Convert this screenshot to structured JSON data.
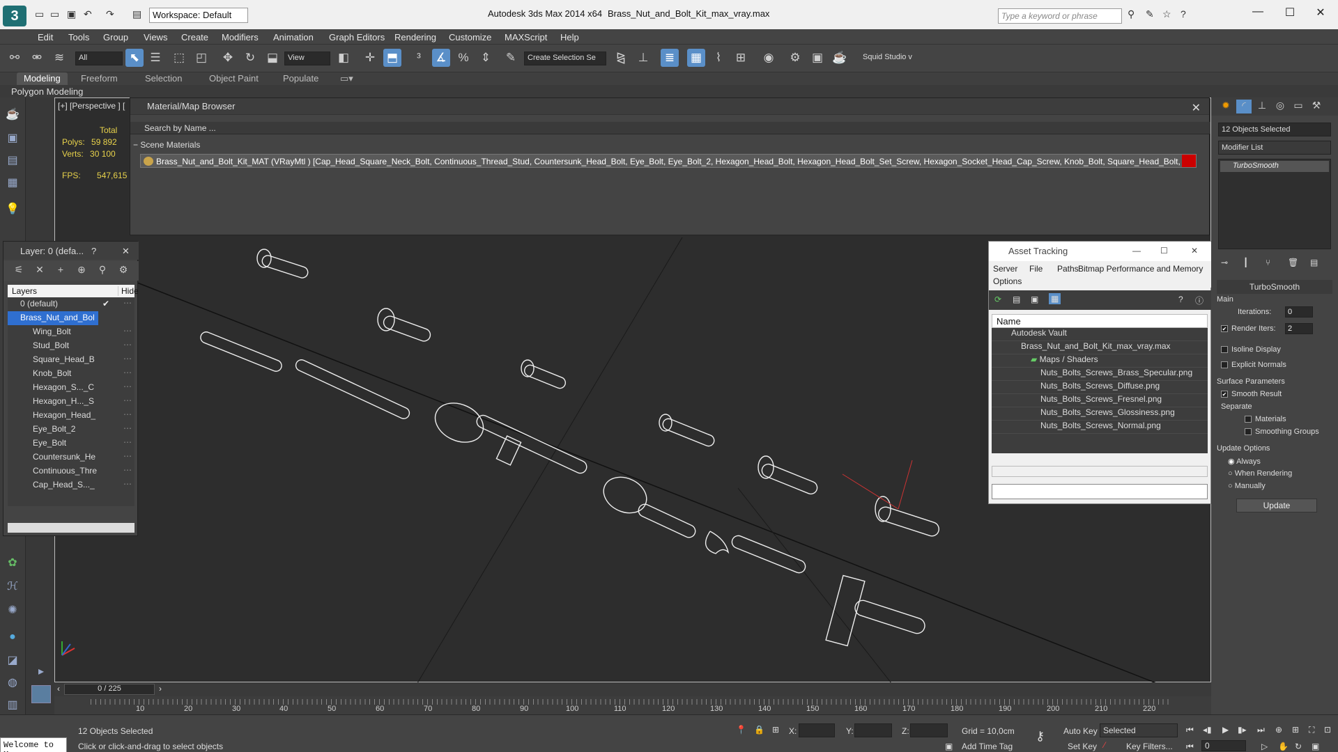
{
  "titlebar": {
    "app": "Autodesk 3ds Max  2014 x64",
    "file": "Brass_Nut_and_Bolt_Kit_max_vray.max",
    "workspace": "Workspace: Default",
    "search_placeholder": "Type a keyword or phrase"
  },
  "menu": [
    "Edit",
    "Tools",
    "Group",
    "Views",
    "Create",
    "Modifiers",
    "Animation",
    "Graph Editors",
    "Rendering",
    "Customize",
    "MAXScript",
    "Help"
  ],
  "toolbar": {
    "filter": "All",
    "refcoord": "View",
    "selset": "Create Selection Se",
    "plugin": "Squid Studio v"
  },
  "ribbon": {
    "tabs": [
      "Modeling",
      "Freeform",
      "Selection",
      "Object Paint",
      "Populate"
    ],
    "sub": "Polygon Modeling"
  },
  "viewport": {
    "label": "[+] [Perspective ] [",
    "stats": {
      "total": "Total",
      "polys_label": "Polys:",
      "polys": "59 892",
      "verts_label": "Verts:",
      "verts": "30 100",
      "fps_label": "FPS:",
      "fps": "547,615"
    }
  },
  "material_browser": {
    "title": "Material/Map Browser",
    "search": "Search by Name ...",
    "group": "Scene Materials",
    "material": "Brass_Nut_and_Bolt_Kit_MAT (VRayMtl ) [Cap_Head_Square_Neck_Bolt, Continuous_Thread_Stud, Countersunk_Head_Bolt, Eye_Bolt, Eye_Bolt_2, Hexagon_Head_Bolt, Hexagon_Head_Bolt_Set_Screw, Hexagon_Socket_Head_Cap_Screw, Knob_Bolt, Square_Head_Bolt, Stud_Bolt, Wing_Bolt]"
  },
  "layer": {
    "title": "Layer: 0 (defa...",
    "help": "?",
    "col_layers": "Layers",
    "col_hide": "Hide",
    "rows": [
      "0 (default)",
      "Brass_Nut_and_Bol",
      "Wing_Bolt",
      "Stud_Bolt",
      "Square_Head_B",
      "Knob_Bolt",
      "Hexagon_S..._C",
      "Hexagon_H..._S",
      "Hexagon_Head_",
      "Eye_Bolt_2",
      "Eye_Bolt",
      "Countersunk_He",
      "Continuous_Thre",
      "Cap_Head_S..._"
    ]
  },
  "asset": {
    "title": "Asset Tracking",
    "menu": {
      "server": "Server",
      "file": "File",
      "paths": "Paths",
      "bitmap": "Bitmap Performance and Memory",
      "options": "Options"
    },
    "col_name": "Name",
    "rows": [
      "Autodesk Vault",
      "Brass_Nut_and_Bolt_Kit_max_vray.max",
      "Maps / Shaders",
      "Nuts_Bolts_Screws_Brass_Specular.png",
      "Nuts_Bolts_Screws_Diffuse.png",
      "Nuts_Bolts_Screws_Fresnel.png",
      "Nuts_Bolts_Screws_Glossiness.png",
      "Nuts_Bolts_Screws_Normal.png"
    ]
  },
  "command": {
    "selected": "12 Objects Selected",
    "modlist": "Modifier List",
    "stack_item": "TurboSmooth",
    "roll_title": "TurboSmooth",
    "main": "Main",
    "iterations_label": "Iterations:",
    "iterations": "0",
    "render_iters_label": "Render Iters:",
    "render_iters": "2",
    "isoline": "Isoline Display",
    "explicit": "Explicit Normals",
    "surface": "Surface Parameters",
    "smooth": "Smooth Result",
    "separate": "Separate",
    "materials": "Materials",
    "smoothing": "Smoothing Groups",
    "update_opts": "Update Options",
    "always": "Always",
    "when_render": "When Rendering",
    "manually": "Manually",
    "update": "Update"
  },
  "timeline": {
    "slider": "0 / 225",
    "ticks": [
      "10",
      "20",
      "30",
      "40",
      "50",
      "60",
      "70",
      "80",
      "90",
      "100",
      "110",
      "120",
      "130",
      "140",
      "150",
      "160",
      "170",
      "180",
      "190",
      "200",
      "210",
      "220"
    ]
  },
  "status": {
    "welcome": "Welcome to M",
    "selected": "12 Objects Selected",
    "prompt": "Click or click-and-drag to select objects",
    "x": "X:",
    "y": "Y:",
    "z": "Z:",
    "grid": "Grid = 10,0cm",
    "add_time_tag": "Add Time Tag",
    "auto_key": "Auto Key",
    "set_key": "Set Key",
    "key_mode": "Selected",
    "key_filters": "Key Filters...",
    "frame": "0"
  }
}
